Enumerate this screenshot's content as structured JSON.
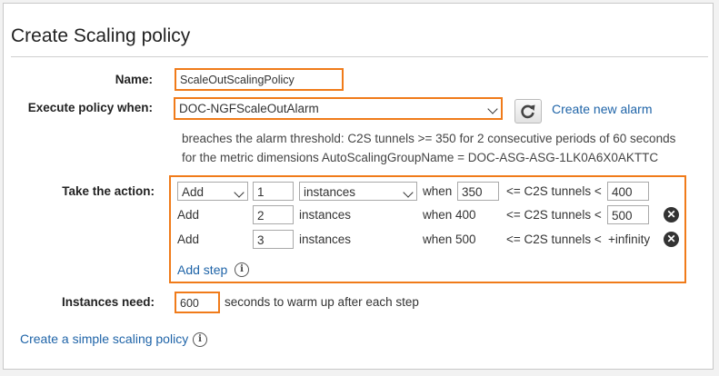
{
  "title": "Create Scaling policy",
  "name_label": "Name:",
  "name_value": "ScaleOutScalingPolicy",
  "execute_label": "Execute policy when:",
  "alarm_value": "DOC-NGFScaleOutAlarm",
  "create_alarm": "Create new alarm",
  "alarm_desc_1": "breaches the alarm threshold: C2S tunnels >= 350 for 2 consecutive periods of 60 seconds",
  "alarm_desc_2": "for the metric dimensions AutoScalingGroupName = DOC-ASG-ASG-1LK0A6X0AKTTC",
  "action_label": "Take the action:",
  "steps": [
    {
      "action": "Add",
      "count": "1",
      "unit": "instances",
      "when": "when",
      "lower": "350",
      "metric": "<= C2S tunnels <",
      "upper": "400"
    },
    {
      "action": "Add",
      "count": "2",
      "unit": "instances",
      "when": "when 400",
      "metric": "<= C2S tunnels <",
      "upper": "500"
    },
    {
      "action": "Add",
      "count": "3",
      "unit": "instances",
      "when": "when 500",
      "metric": "<= C2S tunnels <",
      "upper": "+infinity"
    }
  ],
  "add_step": "Add step",
  "instances_label": "Instances need:",
  "warmup_value": "600",
  "warmup_suffix": "seconds to warm up after each step",
  "simple_policy_link": "Create a simple scaling policy",
  "icons": {
    "refresh": "refresh-icon",
    "remove": "remove-circle-icon",
    "info": "info-icon"
  }
}
